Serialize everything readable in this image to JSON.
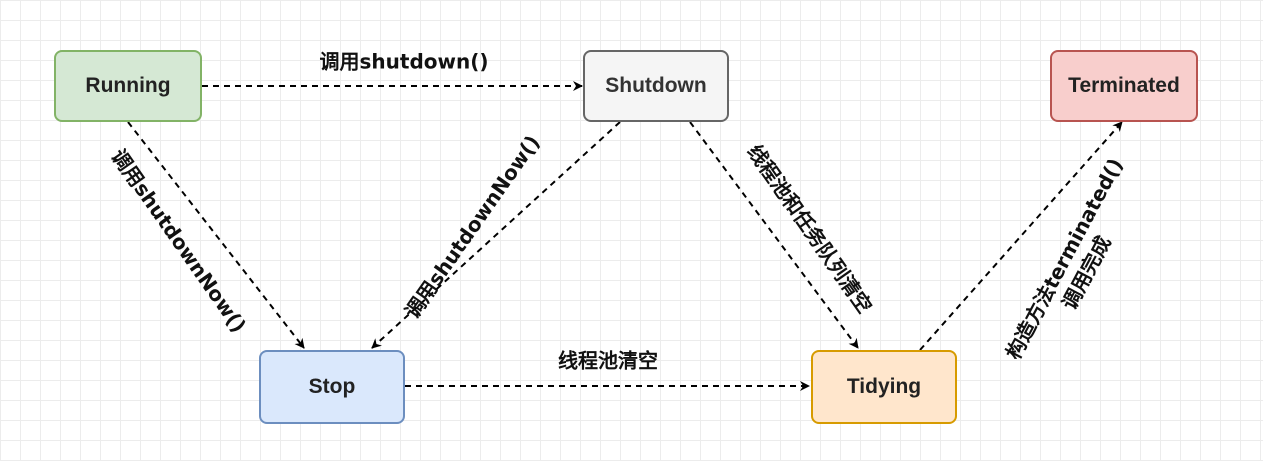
{
  "colors": {
    "running_fill": "#d5e8d4",
    "running_stroke": "#82b366",
    "shutdown_fill": "#f5f5f5",
    "shutdown_stroke": "#666666",
    "terminated_fill": "#f8cecc",
    "terminated_stroke": "#b85450",
    "stop_fill": "#dae8fc",
    "stop_stroke": "#6c8ebf",
    "tidying_fill": "#ffe6cc",
    "tidying_stroke": "#d79b00",
    "edge": "#000000"
  },
  "nodes": {
    "running": "Running",
    "shutdown": "Shutdown",
    "terminated": "Terminated",
    "stop": "Stop",
    "tidying": "Tidying"
  },
  "edges": {
    "running_to_shutdown": "调用shutdown()",
    "running_to_stop": "调用shutdownNow()",
    "shutdown_to_stop": "调用shutdownNow()",
    "shutdown_to_tidying": "线程池和任务队列清空",
    "stop_to_tidying": "线程池清空",
    "tidying_to_terminated_line1": "构造方法terminated()",
    "tidying_to_terminated_line2": "调用完成"
  }
}
